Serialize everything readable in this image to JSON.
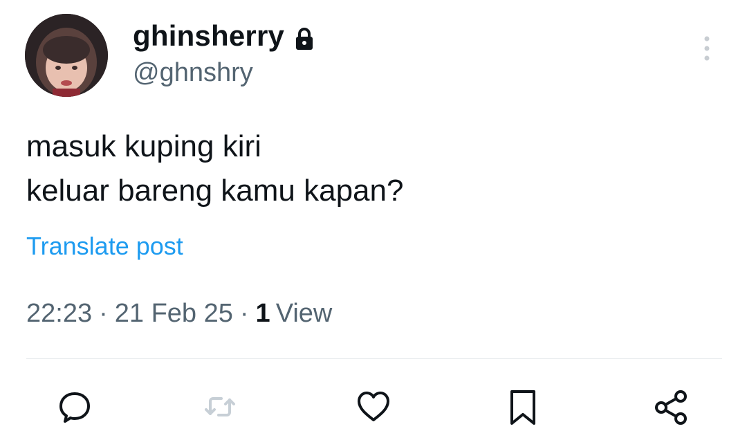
{
  "author": {
    "display_name": "ghinsherry",
    "handle": "@ghnshry",
    "protected_icon": "lock-icon",
    "avatar": "profile-photo"
  },
  "post": {
    "lines": [
      "masuk kuping kiri",
      "keluar bareng kamu kapan?"
    ],
    "translate_label": "Translate post"
  },
  "meta": {
    "time": "22:23",
    "separator": "·",
    "date": "21 Feb 25",
    "views_count": "1",
    "views_label": "View"
  },
  "actions": {
    "reply_icon": "reply-icon",
    "repost_icon": "repost-icon",
    "like_icon": "heart-icon",
    "bookmark_icon": "bookmark-icon",
    "share_icon": "share-icon"
  },
  "colors": {
    "text": "#0f1419",
    "secondary": "#536471",
    "link": "#1d9bf0",
    "divider": "#e6eaed",
    "disabled_icon": "#c7cfd6"
  }
}
